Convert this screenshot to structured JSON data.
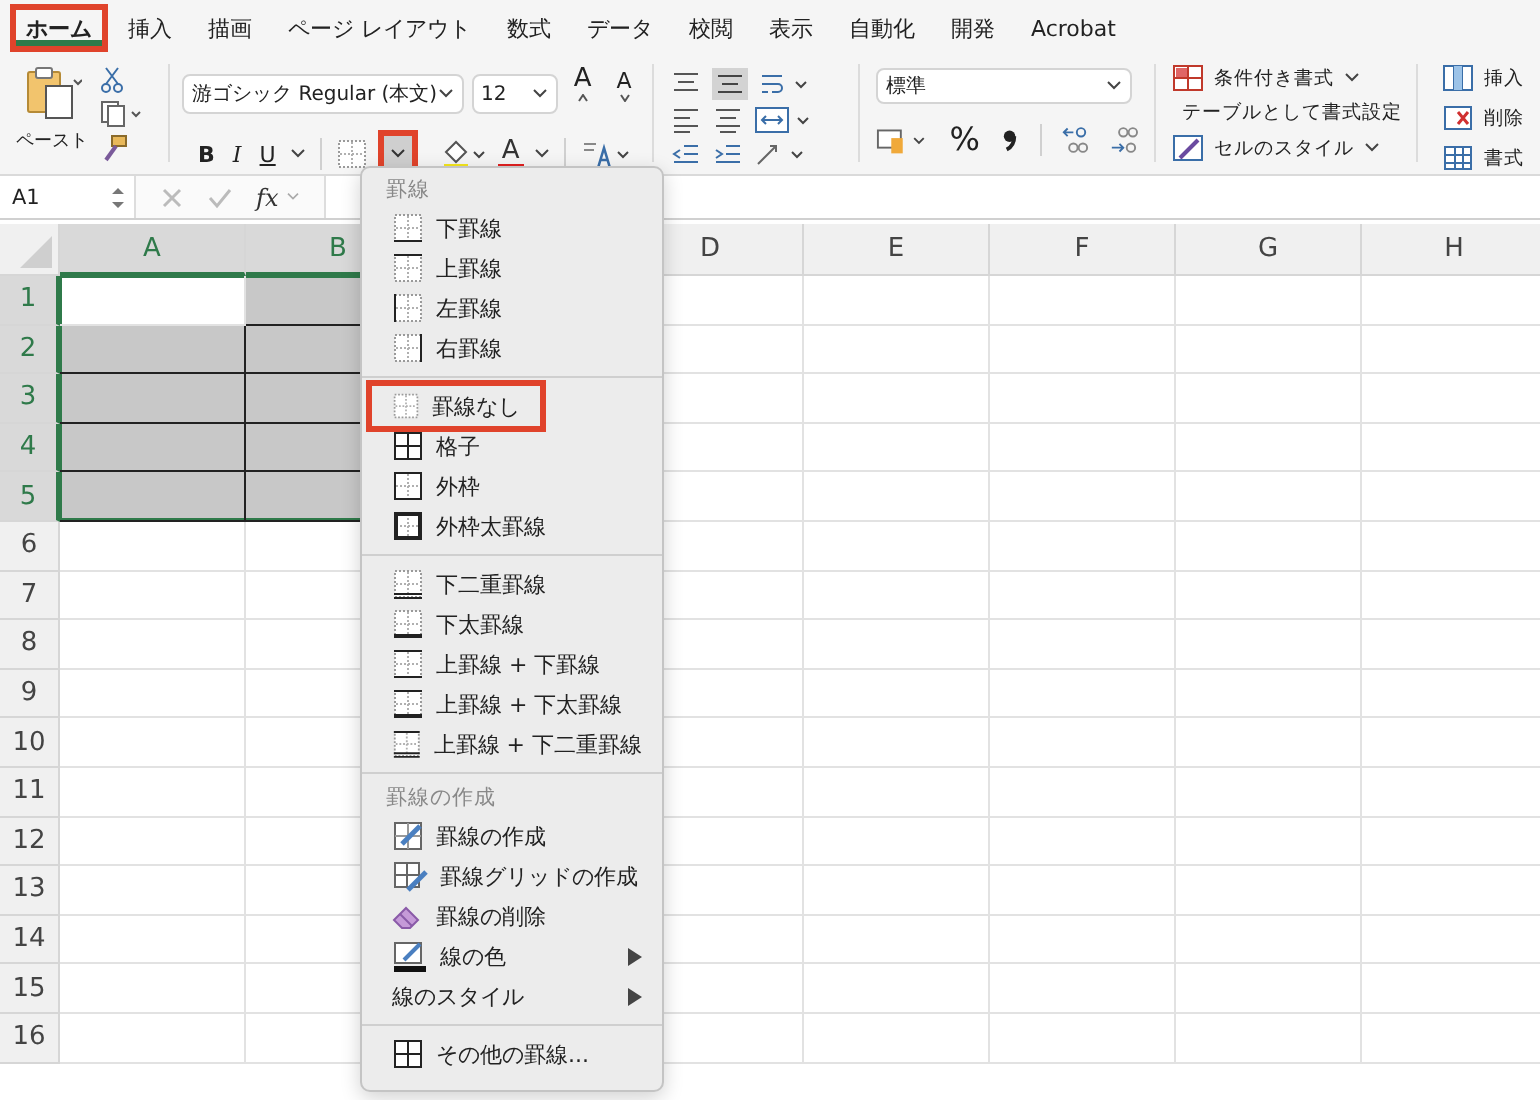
{
  "ribbon_tabs": [
    {
      "label": "ホーム",
      "selected": true,
      "highlighted": true
    },
    {
      "label": "挿入",
      "selected": false,
      "highlighted": false
    },
    {
      "label": "描画",
      "selected": false,
      "highlighted": false
    },
    {
      "label": "ページ レイアウト",
      "selected": false,
      "highlighted": false
    },
    {
      "label": "数式",
      "selected": false,
      "highlighted": false
    },
    {
      "label": "データ",
      "selected": false,
      "highlighted": false
    },
    {
      "label": "校閲",
      "selected": false,
      "highlighted": false
    },
    {
      "label": "表示",
      "selected": false,
      "highlighted": false
    },
    {
      "label": "自動化",
      "selected": false,
      "highlighted": false
    },
    {
      "label": "開発",
      "selected": false,
      "highlighted": false
    },
    {
      "label": "Acrobat",
      "selected": false,
      "highlighted": false
    }
  ],
  "clipboard": {
    "paste_label": "ペースト"
  },
  "font": {
    "name": "游ゴシック Regular (本文)",
    "size": "12",
    "grow_label": "A",
    "shrink_label": "A",
    "bold_label": "B",
    "italic_label": "I",
    "underline_label": "U",
    "font_color_label": "A",
    "borders_dropdown_highlighted": true
  },
  "number": {
    "format": "標準",
    "percent_label": "%"
  },
  "styles": [
    {
      "label": "条件付き書式",
      "kind": "conditional"
    },
    {
      "label": "テーブルとして書式設定",
      "kind": "table"
    },
    {
      "label": "セルのスタイル",
      "kind": "cell_style"
    }
  ],
  "cells_group": [
    {
      "label": "挿入",
      "kind": "insert"
    },
    {
      "label": "削除",
      "kind": "delete"
    },
    {
      "label": "書式",
      "kind": "format"
    }
  ],
  "formula_bar": {
    "name_box": "A1",
    "fx_label": "fx"
  },
  "sheet": {
    "columns": [
      {
        "label": "A",
        "selected": true
      },
      {
        "label": "B",
        "selected": true
      },
      {},
      {
        "label": "D",
        "selected": false
      },
      {
        "label": "E",
        "selected": false
      },
      {
        "label": "F",
        "selected": false
      },
      {
        "label": "G",
        "selected": false
      },
      {
        "label": "H",
        "selected": false
      }
    ],
    "rows": [
      {
        "label": "1",
        "selected": true,
        "cells": [
          {
            "shaded": false
          },
          {
            "shaded": true
          }
        ]
      },
      {
        "label": "2",
        "selected": true,
        "cells": [
          {
            "shaded": true
          },
          {
            "shaded": true
          }
        ]
      },
      {
        "label": "3",
        "selected": true,
        "cells": [
          {
            "shaded": true
          },
          {
            "shaded": true
          }
        ]
      },
      {
        "label": "4",
        "selected": true,
        "cells": [
          {
            "shaded": true
          },
          {
            "shaded": true
          }
        ]
      },
      {
        "label": "5",
        "selected": true,
        "cells": [
          {
            "shaded": true
          },
          {
            "shaded": true
          }
        ]
      },
      {
        "label": "6",
        "selected": false
      },
      {
        "label": "7",
        "selected": false
      },
      {
        "label": "8",
        "selected": false
      },
      {
        "label": "9",
        "selected": false
      },
      {
        "label": "10",
        "selected": false
      },
      {
        "label": "11",
        "selected": false
      },
      {
        "label": "12",
        "selected": false
      },
      {
        "label": "13",
        "selected": false
      },
      {
        "label": "14",
        "selected": false
      },
      {
        "label": "15",
        "selected": false
      },
      {
        "label": "16",
        "selected": false
      }
    ]
  },
  "border_menu": {
    "sections": [
      {
        "title": "罫線",
        "items": [
          {
            "label": "下罫線",
            "kind": "bottom",
            "highlighted": false,
            "submenu": false
          },
          {
            "label": "上罫線",
            "kind": "top",
            "highlighted": false,
            "submenu": false
          },
          {
            "label": "左罫線",
            "kind": "left",
            "highlighted": false,
            "submenu": false
          },
          {
            "label": "右罫線",
            "kind": "right",
            "highlighted": false,
            "submenu": false
          }
        ]
      },
      {
        "items": [
          {
            "label": "罫線なし",
            "kind": "none",
            "highlighted": true,
            "submenu": false
          },
          {
            "label": "格子",
            "kind": "all",
            "highlighted": false,
            "submenu": false
          },
          {
            "label": "外枠",
            "kind": "outside",
            "highlighted": false,
            "submenu": false
          },
          {
            "label": "外枠太罫線",
            "kind": "thick_outside",
            "highlighted": false,
            "submenu": false
          }
        ]
      },
      {
        "items": [
          {
            "label": "下二重罫線",
            "kind": "double_bottom",
            "highlighted": false,
            "submenu": false
          },
          {
            "label": "下太罫線",
            "kind": "thick_bottom",
            "highlighted": false,
            "submenu": false
          },
          {
            "label": "上罫線 + 下罫線",
            "kind": "top_bottom",
            "highlighted": false,
            "submenu": false
          },
          {
            "label": "上罫線 + 下太罫線",
            "kind": "top_thick_bottom",
            "highlighted": false,
            "submenu": false
          },
          {
            "label": "上罫線 + 下二重罫線",
            "kind": "top_double_bottom",
            "highlighted": false,
            "submenu": false
          }
        ]
      },
      {
        "title": "罫線の作成",
        "items": [
          {
            "label": "罫線の作成",
            "kind": "draw",
            "highlighted": false,
            "submenu": false
          },
          {
            "label": "罫線グリッドの作成",
            "kind": "draw_grid",
            "highlighted": false,
            "submenu": false
          },
          {
            "label": "罫線の削除",
            "kind": "erase",
            "highlighted": false,
            "submenu": false
          },
          {
            "label": "線の色",
            "kind": "line_color",
            "highlighted": false,
            "submenu": true
          },
          {
            "label": "線のスタイル",
            "kind": "line_style",
            "highlighted": false,
            "submenu": true
          }
        ]
      },
      {
        "items": [
          {
            "label": "その他の罫線...",
            "kind": "more",
            "highlighted": false,
            "submenu": false
          }
        ]
      }
    ]
  }
}
